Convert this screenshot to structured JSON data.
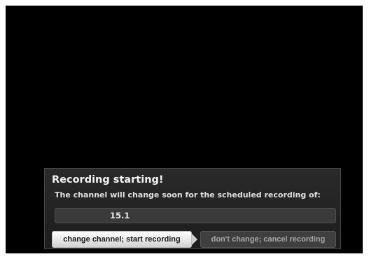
{
  "dialog": {
    "title": "Recording starting!",
    "message": "The channel will change soon for the scheduled recording of:",
    "channel_value": "15.1",
    "primary_button_label": "change channel; start recording",
    "secondary_button_label": "don't change; cancel recording"
  },
  "colors": {
    "screen_background": "#000000",
    "dialog_background": "#252525",
    "primary_button": "#eeeeee",
    "secondary_button": "#3f3f3f"
  },
  "icons": {
    "focus_indicator": "right-arrow-icon"
  }
}
